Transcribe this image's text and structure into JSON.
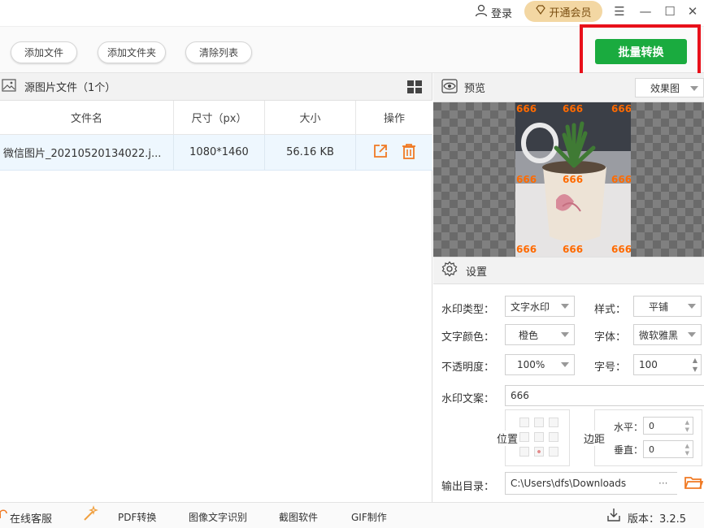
{
  "titlebar": {
    "login_label": "登录",
    "vip_label": "开通会员"
  },
  "toolbar": {
    "add_file": "添加文件",
    "add_folder": "添加文件夹",
    "clear_list": "清除列表",
    "batch_convert": "批量转换"
  },
  "source_panel": {
    "title": "源图片文件（1个）",
    "columns": [
      "文件名",
      "尺寸（px）",
      "大小",
      "操作"
    ],
    "rows": [
      {
        "name": "微信图片_20210520134022.j...",
        "size": "1080*1460",
        "filesize": "56.16 KB"
      }
    ]
  },
  "preview": {
    "title": "预览",
    "mode": "效果图",
    "watermark": "666"
  },
  "settings": {
    "title": "设置",
    "type_label": "水印类型：",
    "type_value": "文字水印",
    "style_label": "样式：",
    "style_value": "平铺",
    "color_label": "文字颜色：",
    "color_value": "橙色",
    "font_label": "字体：",
    "font_value": "微软雅黑",
    "opacity_label": "不透明度：",
    "opacity_value": "100%",
    "size_label": "字号：",
    "size_value": "100",
    "text_label": "水印文案：",
    "text_value": "666",
    "position_label": "位置",
    "margin_label": "边距",
    "h_label": "水平：",
    "h_value": "0",
    "v_label": "垂直：",
    "v_value": "0",
    "output_label": "输出目录：",
    "output_value": "C:\\Users\\dfs\\Downloads",
    "output_more": "···"
  },
  "statusbar": {
    "service": "在线客服",
    "pdf": "PDF转换",
    "ocr": "图像文字识别",
    "screenshot": "截图软件",
    "gif": "GIF制作",
    "version": "版本：3.2.5"
  },
  "colors": {
    "accent_green": "#1aab3f",
    "highlight_red": "#e8101a",
    "watermark_orange": "#ff6a00",
    "action_orange": "#f07a24"
  }
}
